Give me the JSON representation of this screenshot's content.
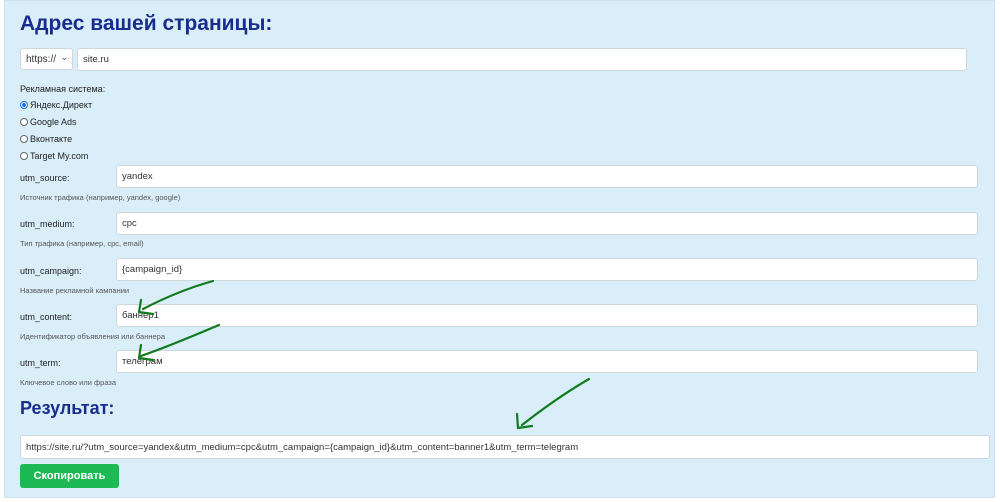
{
  "header": {
    "title": "Адрес вашей страницы:"
  },
  "url": {
    "protocol": "https://",
    "site": "site.ru"
  },
  "ad_system": {
    "label": "Рекламная система:",
    "options": [
      "Яндекс.Директ",
      "Google Ads",
      "Вконтакте",
      "Target My.com"
    ],
    "selected": "Яндекс.Директ"
  },
  "utm": {
    "source": {
      "label": "utm_source:",
      "value": "yandex",
      "hint": "Источник трафика (например, yandex, google)"
    },
    "medium": {
      "label": "utm_medium:",
      "value": "cpc",
      "hint": "Тип трафика (например, cpc, email)"
    },
    "campaign": {
      "label": "utm_campaign:",
      "value": "{campaign_id}",
      "hint": "Название рекламной кампании"
    },
    "content": {
      "label": "utm_content:",
      "value": "баннер1",
      "hint": "Идентификатор объявления или баннера"
    },
    "term": {
      "label": "utm_term:",
      "value": "телеграм",
      "hint": "Ключевое слово или фраза"
    }
  },
  "result": {
    "title": "Результат:",
    "url": "https://site.ru/?utm_source=yandex&utm_medium=cpc&utm_campaign={campaign_id}&utm_content=banner1&utm_term=telegram",
    "copy_label": "Скопировать"
  },
  "colors": {
    "panel": "#d9eef9",
    "heading": "#1a2d8c",
    "button": "#1db954",
    "annotation": "#117a1f"
  }
}
